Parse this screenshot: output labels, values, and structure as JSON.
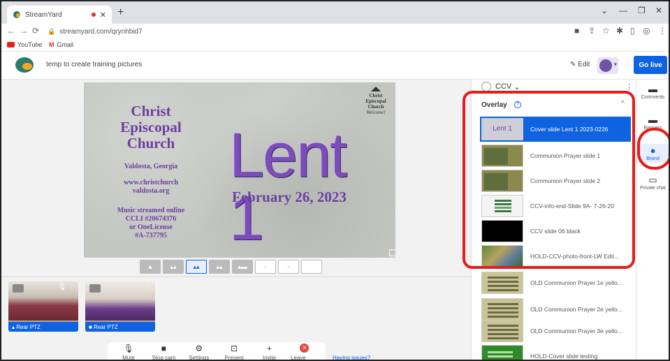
{
  "browser": {
    "tab_title": "StreamYard",
    "url": "streamyard.com/qrynhbid7",
    "bookmarks": [
      "YouTube",
      "Gmail"
    ]
  },
  "studio": {
    "broadcast_title": "temp to create training pictures",
    "edit_label": "Edit",
    "go_live_label": "Go live"
  },
  "slide": {
    "church_lines": [
      "Christ",
      "Episcopal",
      "Church"
    ],
    "city": "Valdosta, Georgia",
    "web_lines": [
      "www.christchurch",
      "valdosta.org"
    ],
    "license_lines": [
      "Music streamed online",
      "CCLI #20674376",
      "or OneLicense",
      "#A-737795"
    ],
    "big_title": "Lent 1",
    "date": "February 26, 2023",
    "seal_lines": [
      "Christ",
      "Episcopal",
      "Church",
      "Welcome!"
    ]
  },
  "cameras": [
    {
      "label": "Rear PTZ"
    },
    {
      "label": "Rear PTZ"
    }
  ],
  "controls": [
    {
      "name": "mute",
      "label": "Mute",
      "icon": "🎙"
    },
    {
      "name": "stop-cam",
      "label": "Stop cam",
      "icon": "■"
    },
    {
      "name": "settings",
      "label": "Settings",
      "icon": "⚙"
    },
    {
      "name": "present",
      "label": "Present",
      "icon": "⊡"
    },
    {
      "name": "invite",
      "label": "Invite",
      "icon": "+"
    },
    {
      "name": "leave-studio",
      "label": "Leave studio",
      "icon": "✕"
    }
  ],
  "having_issues": "Having issues?",
  "panel": {
    "brand_name": "CCV",
    "section_title": "Overlay",
    "overlays": [
      {
        "label": "Cover slide Lent 1 2023-0226",
        "thumb": "lent",
        "active": true
      },
      {
        "label": "Communion Prayer slide 1",
        "thumb": "green",
        "active": false
      },
      {
        "label": "Communion Prayer slide 2",
        "thumb": "green",
        "active": false
      },
      {
        "label": "CCV-info-end-Slide 9A- 7-26-20",
        "thumb": "white",
        "active": false
      },
      {
        "label": "CCV slide 06 black",
        "thumb": "black",
        "active": false
      },
      {
        "label": "HOLD-CCV-photo-front-LW Edit...",
        "thumb": "photo",
        "active": false
      },
      {
        "label": "OLD Communion Prayer 1e yello...",
        "thumb": "yellow",
        "active": false
      },
      {
        "label": "OLD Communion Prayer 2e yello...",
        "thumb": "yellow",
        "active": false
      },
      {
        "label": "OLD Communion Prayer 3e yello...",
        "thumb": "yellow",
        "active": false
      },
      {
        "label": "HOLD-Cover slide testing",
        "thumb": "greendark",
        "active": false
      }
    ]
  },
  "rail": [
    {
      "label": "Comments",
      "icon": "▬"
    },
    {
      "label": "Banners",
      "icon": "▬"
    },
    {
      "label": "Brand",
      "icon": "●"
    },
    {
      "label": "Private chat",
      "icon": "▭"
    }
  ],
  "colors": {
    "accent": "#0f62e0",
    "highlight": "#e41c1c"
  }
}
